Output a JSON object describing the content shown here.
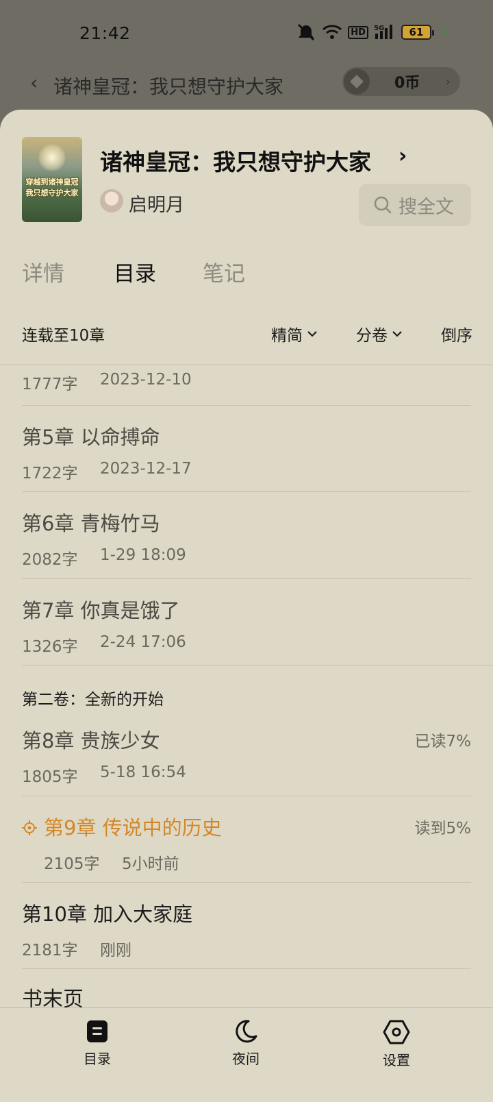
{
  "status_bar": {
    "time": "21:42",
    "signal_badge": "HD",
    "network": "5G",
    "battery": "61",
    "icons": [
      "mute-icon",
      "wifi-icon",
      "hd-icon",
      "signal-icon",
      "battery-icon",
      "charging-icon"
    ]
  },
  "background_nav": {
    "title": "诸神皇冠：我只想守护大家",
    "coins": "0币"
  },
  "book": {
    "cover_text_line1": "穿越到诸神皇冠",
    "cover_text_line2": "我只想守护大家",
    "title": "诸神皇冠：我只想守护大家",
    "author": "启明月",
    "search_label": "搜全文"
  },
  "tabs": [
    {
      "label": "详情",
      "active": false
    },
    {
      "label": "目录",
      "active": true
    },
    {
      "label": "笔记",
      "active": false
    }
  ],
  "catalog_bar": {
    "serial_status": "连载至10章",
    "filter_1": "精简",
    "filter_2": "分卷",
    "order": "倒序"
  },
  "chapters": {
    "partial": {
      "words": "1777字",
      "date": "2023-12-10"
    },
    "ch5": {
      "title": "第5章 以命搏命",
      "words": "1722字",
      "date": "2023-12-17"
    },
    "ch6": {
      "title": "第6章 青梅竹马",
      "words": "2082字",
      "date": "1-29 18:09"
    },
    "ch7": {
      "title": "第7章 你真是饿了",
      "words": "1326字",
      "date": "2-24 17:06"
    },
    "volume2": "第二卷：全新的开始",
    "ch8": {
      "title": "第8章 贵族少女",
      "words": "1805字",
      "date": "5-18 16:54",
      "progress": "已读7%"
    },
    "ch9": {
      "title": "第9章 传说中的历史",
      "words": "2105字",
      "date": "5小时前",
      "progress": "读到5%"
    },
    "ch10": {
      "title": "第10章 加入大家庭",
      "words": "2181字",
      "date": "刚刚"
    },
    "end_page": "书末页"
  },
  "toolbar": {
    "catalog": "目录",
    "night": "夜间",
    "settings": "设置"
  },
  "colors": {
    "sheet_bg": "#ded9c6",
    "accent_current": "#d48727",
    "overlay_bg": "#6f6c63"
  }
}
